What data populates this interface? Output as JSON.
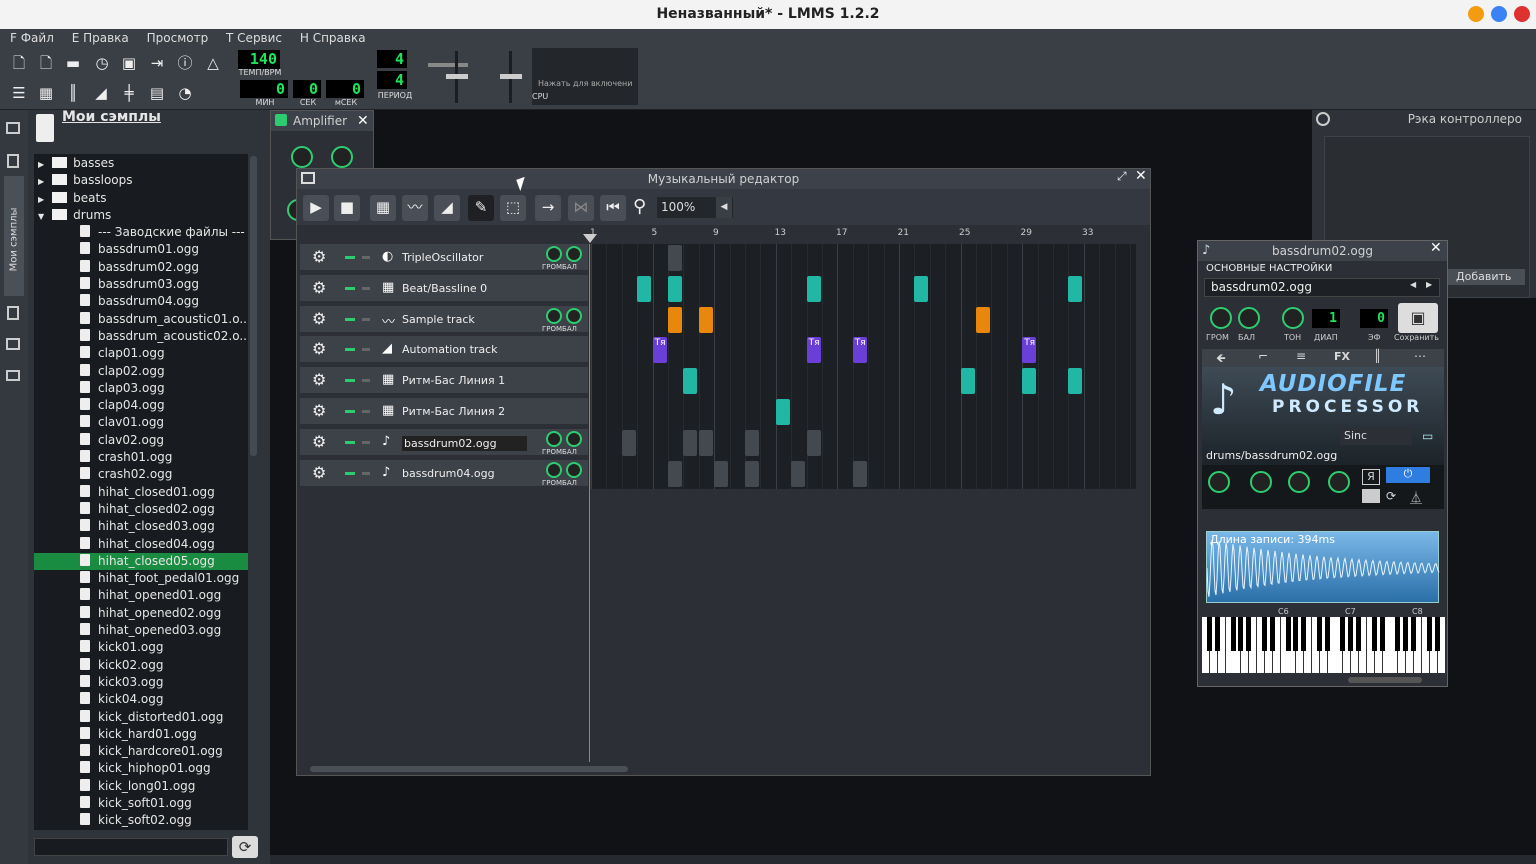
{
  "window": {
    "title": "Неназванный* - LMMS 1.2.2"
  },
  "menu": [
    "F Файл",
    "E Правка",
    "Просмотр",
    "T Сервис",
    "H Справка"
  ],
  "toolbar": {
    "tempo": "140",
    "tempo_label": "ТЕМП/BPM",
    "min": "0",
    "sec": "0",
    "msec": "0",
    "min_label": "МИН",
    "sec_label": "СЕК",
    "msec_label": "мСЕК",
    "num": "4",
    "den": "4",
    "period_label": "ПЕРИОД",
    "cpu_label": "CPU",
    "hint": "Нажать для включени"
  },
  "sidebar": {
    "title": "Мои сэмплы",
    "tab_label": "Мои сэмплы",
    "folders": [
      "basses",
      "bassloops",
      "beats",
      "drums"
    ],
    "files": [
      "--- Заводские файлы ---",
      "bassdrum01.ogg",
      "bassdrum02.ogg",
      "bassdrum03.ogg",
      "bassdrum04.ogg",
      "bassdrum_acoustic01.o...",
      "bassdrum_acoustic02.o...",
      "clap01.ogg",
      "clap02.ogg",
      "clap03.ogg",
      "clap04.ogg",
      "clav01.ogg",
      "clav02.ogg",
      "crash01.ogg",
      "crash02.ogg",
      "hihat_closed01.ogg",
      "hihat_closed02.ogg",
      "hihat_closed03.ogg",
      "hihat_closed04.ogg",
      "hihat_closed05.ogg",
      "hihat_foot_pedal01.ogg",
      "hihat_opened01.ogg",
      "hihat_opened02.ogg",
      "hihat_opened03.ogg",
      "kick01.ogg",
      "kick02.ogg",
      "kick03.ogg",
      "kick04.ogg",
      "kick_distorted01.ogg",
      "kick_hard01.ogg",
      "kick_hardcore01.ogg",
      "kick_hiphop01.ogg",
      "kick_long01.ogg",
      "kick_soft01.ogg",
      "kick_soft02.ogg"
    ],
    "selected": "hihat_closed05.ogg"
  },
  "amplifier": {
    "title": "Amplifier"
  },
  "song_editor": {
    "title": "Музыкальный редактор",
    "zoom": "100%",
    "bars": [
      "1",
      "5",
      "9",
      "13",
      "17",
      "21",
      "25",
      "29",
      "33"
    ],
    "tracks": [
      {
        "name": "TripleOscillator",
        "knobs": "ГРОМБАЛ"
      },
      {
        "name": "Beat/Bassline 0",
        "knobs": ""
      },
      {
        "name": "Sample track",
        "knobs": "ГРОМБАЛ"
      },
      {
        "name": "Automation track",
        "knobs": ""
      },
      {
        "name": "Ритм-Бас Линия 1",
        "knobs": ""
      },
      {
        "name": "Ритм-Бас Линия 2",
        "knobs": ""
      },
      {
        "name": "bassdrum02.ogg",
        "knobs": "ГРОМБАЛ"
      },
      {
        "name": "bassdrum04.ogg",
        "knobs": "ГРОМБАЛ"
      }
    ],
    "automation_label": "Тя"
  },
  "rack": {
    "title": "Рэка контроллеро",
    "add_label": "Добавить"
  },
  "afp": {
    "title": "bassdrum02.ogg",
    "section": "ОСНОВНЫЕ НАСТРОЙКИ",
    "name": "bassdrum02.ogg",
    "labels": [
      "ГРОМ",
      "БАЛ",
      "ТОН",
      "ДИАП",
      "ЭФ",
      "Сохранить"
    ],
    "diap": "1",
    "fx": "0",
    "tabs": [
      "FX"
    ],
    "logo1": "AUDIOFILE",
    "logo2": "PROCESSOR",
    "interp": "Sinc",
    "path": "drums/bassdrum02.ogg",
    "length": "Длина записи: 394ms",
    "keys": [
      "C6",
      "C7",
      "C8"
    ],
    "ya": "Я"
  }
}
